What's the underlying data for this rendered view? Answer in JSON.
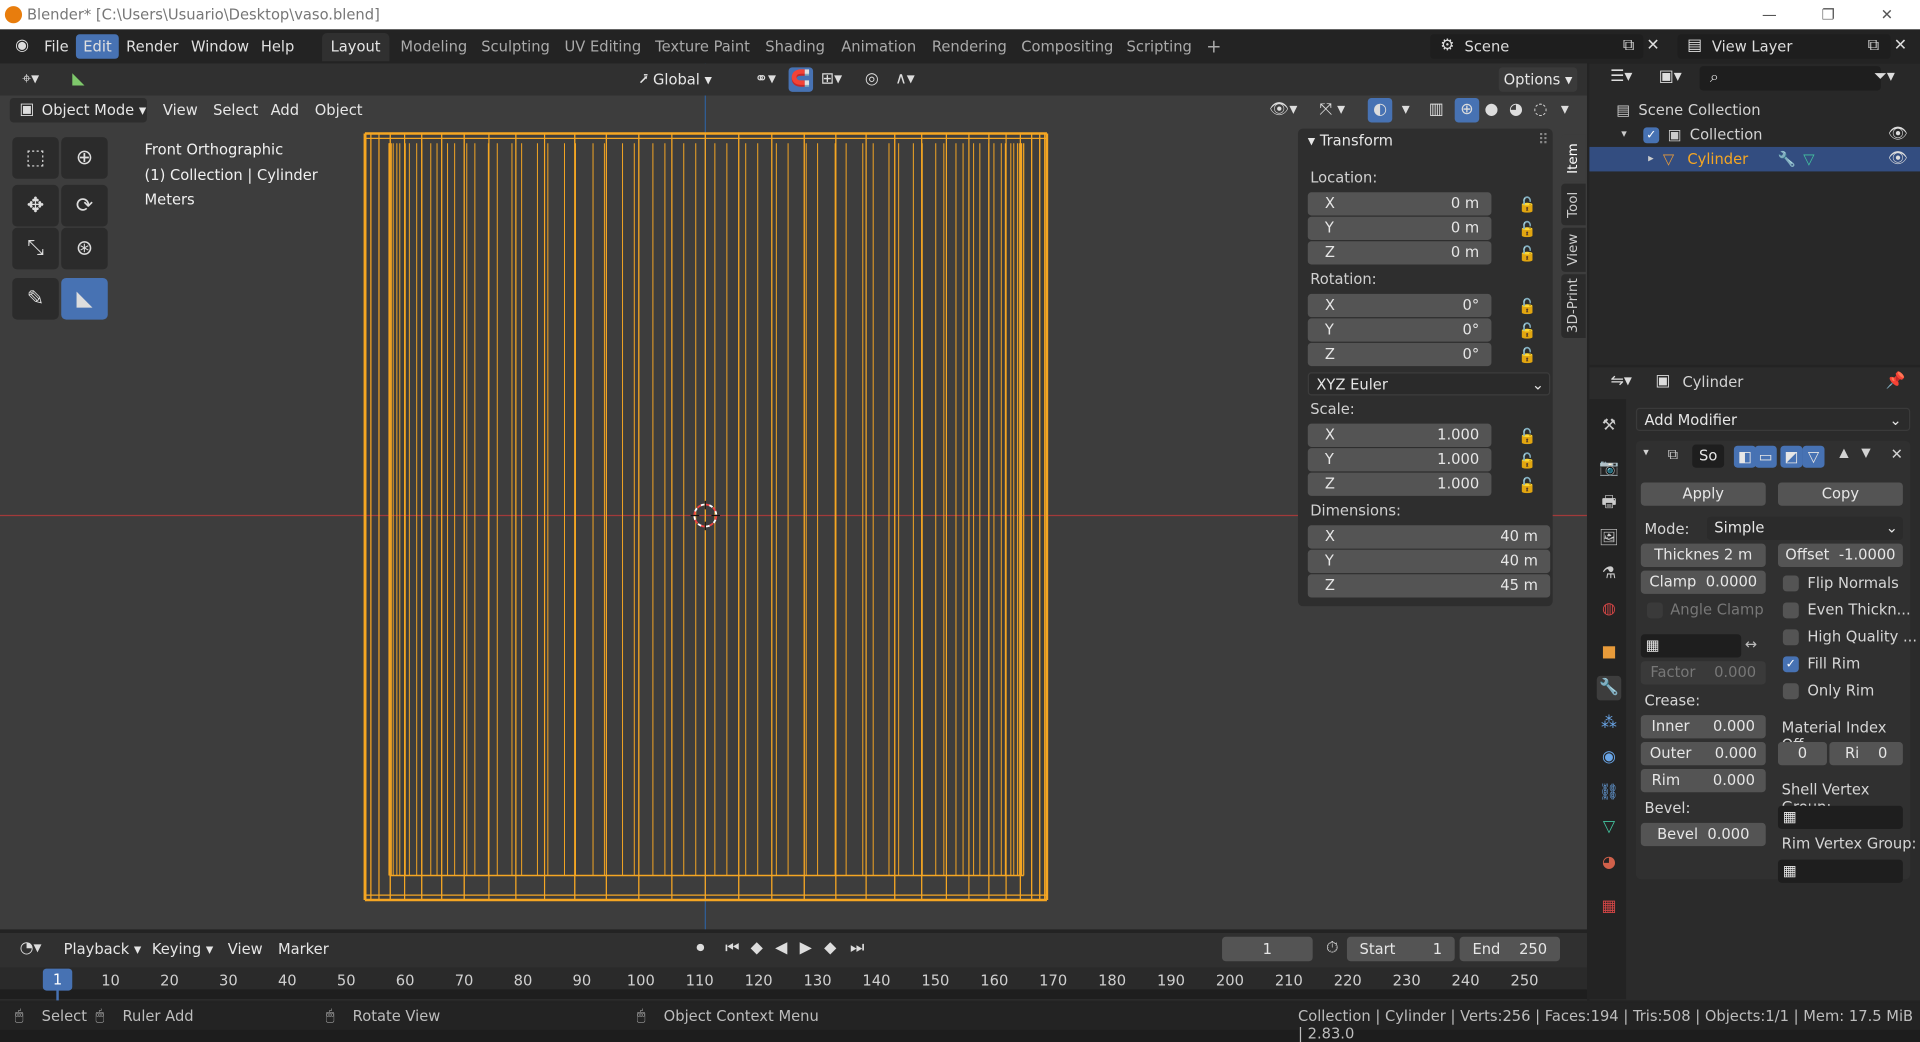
{
  "title": "Blender* [C:\\Users\\Usuario\\Desktop\\vaso.blend]",
  "menus": [
    "File",
    "Edit",
    "Render",
    "Window",
    "Help"
  ],
  "workspaces": [
    "Layout",
    "Modeling",
    "Sculpting",
    "UV Editing",
    "Texture Paint",
    "Shading",
    "Animation",
    "Rendering",
    "Compositing",
    "Scripting"
  ],
  "scene": "Scene",
  "view_layer": "View Layer",
  "viewport": {
    "orientation": "Global",
    "options": "Options",
    "mode": "Object Mode",
    "menus": [
      "View",
      "Select",
      "Add",
      "Object"
    ],
    "overlay_lines": [
      "Front Orthographic",
      "(1) Collection | Cylinder",
      "Meters"
    ]
  },
  "transform": {
    "title": "Transform",
    "location_label": "Location:",
    "location": [
      {
        "k": "X",
        "v": "0 m"
      },
      {
        "k": "Y",
        "v": "0 m"
      },
      {
        "k": "Z",
        "v": "0 m"
      }
    ],
    "rotation_label": "Rotation:",
    "rotation": [
      {
        "k": "X",
        "v": "0°"
      },
      {
        "k": "Y",
        "v": "0°"
      },
      {
        "k": "Z",
        "v": "0°"
      }
    ],
    "rotation_mode": "XYZ Euler",
    "scale_label": "Scale:",
    "scale": [
      {
        "k": "X",
        "v": "1.000"
      },
      {
        "k": "Y",
        "v": "1.000"
      },
      {
        "k": "Z",
        "v": "1.000"
      }
    ],
    "dimensions_label": "Dimensions:",
    "dimensions": [
      {
        "k": "X",
        "v": "40 m"
      },
      {
        "k": "Y",
        "v": "40 m"
      },
      {
        "k": "Z",
        "v": "45 m"
      }
    ]
  },
  "sidebar_tabs": [
    "Item",
    "Tool",
    "View",
    "3D-Print"
  ],
  "outliner": {
    "scene_collection": "Scene Collection",
    "collection": "Collection",
    "object": "Cylinder"
  },
  "properties": {
    "object_name": "Cylinder",
    "add_modifier": "Add Modifier",
    "modifier_name": "So",
    "apply": "Apply",
    "copy": "Copy",
    "mode_label": "Mode:",
    "mode_value": "Simple",
    "thickness": "Thicknes 2 m",
    "offset_label": "Offset",
    "offset_value": "-1.0000",
    "clamp_label": "Clamp",
    "clamp_value": "0.0000",
    "angle_clamp": "Angle Clamp",
    "factor_label": "Factor",
    "factor_value": "0.000",
    "crease_label": "Crease:",
    "inner_label": "Inner",
    "inner_value": "0.000",
    "outer_label": "Outer",
    "outer_value": "0.000",
    "rim_label": "Rim",
    "rim_value": "0.000",
    "bevel_section": "Bevel:",
    "bevel_label": "Bevel",
    "bevel_value": "0.000",
    "flip_normals": "Flip Normals",
    "even_thickness": "Even Thickn...",
    "high_quality": "High Quality ...",
    "fill_rim": "Fill Rim",
    "only_rim": "Only Rim",
    "material_index": "Material Index Off...",
    "mat_value1": "0",
    "mat_ri_label": "Ri",
    "mat_value2": "0",
    "shell_vgroup": "Shell Vertex Group:",
    "rim_vgroup": "Rim Vertex Group:"
  },
  "timeline": {
    "menus": [
      "Playback",
      "Keying",
      "View",
      "Marker"
    ],
    "current_frame": "1",
    "start_label": "Start",
    "start_value": "1",
    "end_label": "End",
    "end_value": "250",
    "ticks": [
      "1",
      "10",
      "20",
      "30",
      "40",
      "50",
      "60",
      "70",
      "80",
      "90",
      "100",
      "110",
      "120",
      "130",
      "140",
      "150",
      "160",
      "170",
      "180",
      "190",
      "200",
      "210",
      "220",
      "230",
      "240",
      "250"
    ]
  },
  "status": {
    "select": "Select",
    "ruler_add": "Ruler Add",
    "rotate_view": "Rotate View",
    "context_menu": "Object Context Menu",
    "stats": "Collection | Cylinder | Verts:256 | Faces:194 | Tris:508 | Objects:1/1 | Mem: 17.5 MiB | 2.83.0"
  },
  "colors": {
    "accent": "#4772b3",
    "selection": "#f5a623",
    "axis_x": "#c83c3c",
    "axis_z": "#3a78c8"
  }
}
